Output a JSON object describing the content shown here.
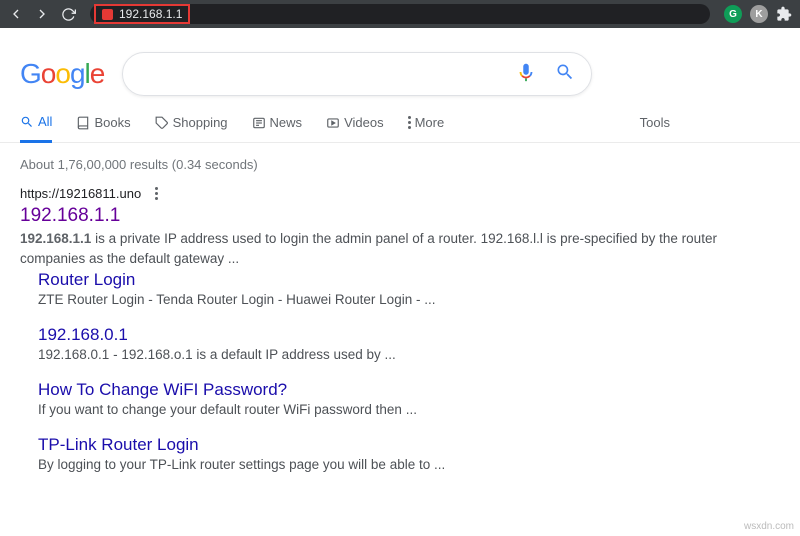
{
  "browser": {
    "url": "192.168.1.1"
  },
  "logo": {
    "g1": "G",
    "o1": "o",
    "o2": "o",
    "g2": "g",
    "l": "l",
    "e": "e"
  },
  "tabs": {
    "all": "All",
    "books": "Books",
    "shopping": "Shopping",
    "news": "News",
    "videos": "Videos",
    "more": "More",
    "tools": "Tools"
  },
  "stats": "About 1,76,00,000 results (0.34 seconds)",
  "main_result": {
    "url": "https://19216811.uno",
    "title": "192.168.1.1",
    "snippet_bold": "192.168.1.1",
    "snippet_rest": " is a private IP address used to login the admin panel of a router. 192.168.l.l is pre-specified by the router companies as the default gateway ..."
  },
  "sub": [
    {
      "title": "Router Login",
      "snippet": "ZTE Router Login - Tenda Router Login - Huawei Router Login - ..."
    },
    {
      "title": "192.168.0.1",
      "snippet": "192.168.0.1 - 192.168.o.1 is a default IP address used by ..."
    },
    {
      "title": "How To Change WiFI Password?",
      "snippet": "If you want to change your default router WiFi password then ..."
    },
    {
      "title": "TP-Link Router Login",
      "snippet": "By logging to your TP-Link router settings page you will be able to ..."
    }
  ],
  "watermark": "wsxdn.com"
}
